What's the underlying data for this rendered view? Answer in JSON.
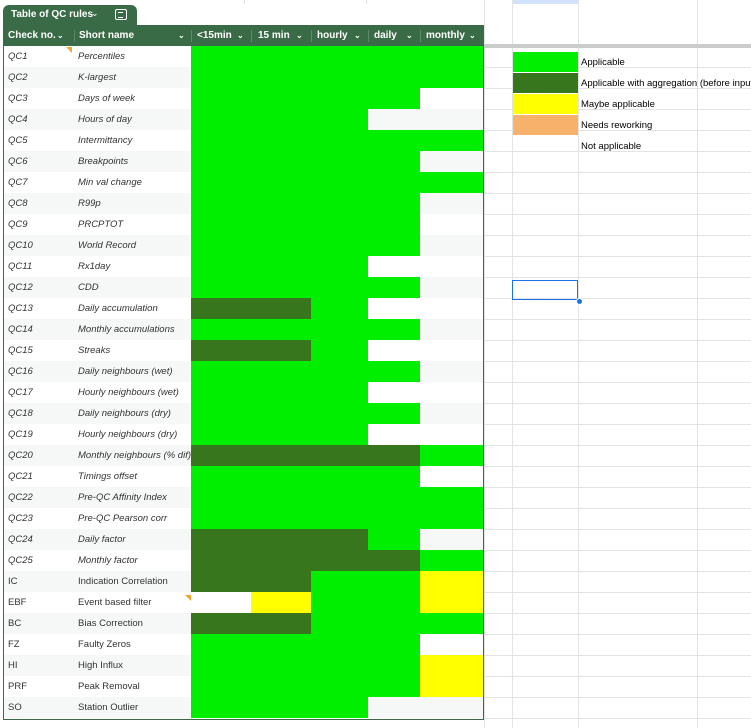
{
  "table": {
    "name": "Table of QC rules",
    "columns": [
      "Check no.",
      "Short name",
      "<15min",
      "15 min",
      "hourly",
      "daily",
      "monthly"
    ],
    "rows": [
      {
        "id": "QC1",
        "name": "Percentiles",
        "cells": [
          "applicable",
          "applicable",
          "applicable",
          "applicable",
          "applicable"
        ]
      },
      {
        "id": "QC2",
        "name": "K-largest",
        "cells": [
          "applicable",
          "applicable",
          "applicable",
          "applicable",
          "applicable"
        ]
      },
      {
        "id": "QC3",
        "name": "Days of week",
        "cells": [
          "applicable",
          "applicable",
          "applicable",
          "applicable",
          "not_applicable"
        ]
      },
      {
        "id": "QC4",
        "name": "Hours of day",
        "cells": [
          "applicable",
          "applicable",
          "applicable",
          "not_applicable",
          "not_applicable"
        ]
      },
      {
        "id": "QC5",
        "name": "Intermittancy",
        "cells": [
          "applicable",
          "applicable",
          "applicable",
          "applicable",
          "applicable"
        ]
      },
      {
        "id": "QC6",
        "name": "Breakpoints",
        "cells": [
          "applicable",
          "applicable",
          "applicable",
          "applicable",
          "not_applicable"
        ]
      },
      {
        "id": "QC7",
        "name": "Min val change",
        "cells": [
          "applicable",
          "applicable",
          "applicable",
          "applicable",
          "applicable"
        ]
      },
      {
        "id": "QC8",
        "name": "R99p",
        "cells": [
          "applicable",
          "applicable",
          "applicable",
          "applicable",
          "not_applicable"
        ]
      },
      {
        "id": "QC9",
        "name": "PRCPTOT",
        "cells": [
          "applicable",
          "applicable",
          "applicable",
          "applicable",
          "not_applicable"
        ]
      },
      {
        "id": "QC10",
        "name": "World Record",
        "cells": [
          "applicable",
          "applicable",
          "applicable",
          "applicable",
          "not_applicable"
        ]
      },
      {
        "id": "QC11",
        "name": "Rx1day",
        "cells": [
          "applicable",
          "applicable",
          "applicable",
          "not_applicable",
          "not_applicable"
        ]
      },
      {
        "id": "QC12",
        "name": "CDD",
        "cells": [
          "applicable",
          "applicable",
          "applicable",
          "applicable",
          "not_applicable"
        ]
      },
      {
        "id": "QC13",
        "name": "Daily accumulation",
        "cells": [
          "aggregation",
          "aggregation",
          "applicable",
          "not_applicable",
          "not_applicable"
        ]
      },
      {
        "id": "QC14",
        "name": "Monthly accumulations",
        "cells": [
          "applicable",
          "applicable",
          "applicable",
          "applicable",
          "not_applicable"
        ]
      },
      {
        "id": "QC15",
        "name": "Streaks",
        "cells": [
          "aggregation",
          "aggregation",
          "applicable",
          "not_applicable",
          "not_applicable"
        ]
      },
      {
        "id": "QC16",
        "name": "Daily neighbours (wet)",
        "cells": [
          "applicable",
          "applicable",
          "applicable",
          "applicable",
          "not_applicable"
        ]
      },
      {
        "id": "QC17",
        "name": "Hourly neighbours (wet)",
        "cells": [
          "applicable",
          "applicable",
          "applicable",
          "not_applicable",
          "not_applicable"
        ]
      },
      {
        "id": "QC18",
        "name": "Daily neighbours (dry)",
        "cells": [
          "applicable",
          "applicable",
          "applicable",
          "applicable",
          "not_applicable"
        ]
      },
      {
        "id": "QC19",
        "name": "Hourly neighbours (dry)",
        "cells": [
          "applicable",
          "applicable",
          "applicable",
          "not_applicable",
          "not_applicable"
        ]
      },
      {
        "id": "QC20",
        "name": "Monthly neighbours (% dif)",
        "cells": [
          "aggregation",
          "aggregation",
          "aggregation",
          "aggregation",
          "applicable"
        ]
      },
      {
        "id": "QC21",
        "name": "Timings offset",
        "cells": [
          "applicable",
          "applicable",
          "applicable",
          "applicable",
          "not_applicable"
        ]
      },
      {
        "id": "QC22",
        "name": "Pre-QC Affinity Index",
        "cells": [
          "applicable",
          "applicable",
          "applicable",
          "applicable",
          "applicable"
        ]
      },
      {
        "id": "QC23",
        "name": "Pre-QC Pearson corr",
        "cells": [
          "applicable",
          "applicable",
          "applicable",
          "applicable",
          "applicable"
        ]
      },
      {
        "id": "QC24",
        "name": "Daily factor",
        "cells": [
          "aggregation",
          "aggregation",
          "aggregation",
          "applicable",
          "not_applicable"
        ]
      },
      {
        "id": "QC25",
        "name": "Monthly factor",
        "cells": [
          "aggregation",
          "aggregation",
          "aggregation",
          "aggregation",
          "applicable"
        ]
      },
      {
        "id": "IC",
        "name": "Indication Correlation",
        "cells": [
          "aggregation",
          "aggregation",
          "applicable",
          "applicable",
          "maybe"
        ]
      },
      {
        "id": "EBF",
        "name": "Event based filter",
        "cells": [
          "not_applicable",
          "maybe",
          "applicable",
          "applicable",
          "maybe"
        ]
      },
      {
        "id": "BC",
        "name": "Bias Correction",
        "cells": [
          "aggregation",
          "aggregation",
          "applicable",
          "applicable",
          "applicable"
        ]
      },
      {
        "id": "FZ",
        "name": "Faulty Zeros",
        "cells": [
          "applicable",
          "applicable",
          "applicable",
          "applicable",
          "not_applicable"
        ]
      },
      {
        "id": "HI",
        "name": "High Influx",
        "cells": [
          "applicable",
          "applicable",
          "applicable",
          "applicable",
          "maybe"
        ]
      },
      {
        "id": "PRF",
        "name": "Peak Removal",
        "cells": [
          "applicable",
          "applicable",
          "applicable",
          "applicable",
          "maybe"
        ]
      },
      {
        "id": "SO",
        "name": "Station Outlier",
        "cells": [
          "applicable",
          "applicable",
          "applicable",
          "not_applicable",
          "not_applicable"
        ]
      }
    ]
  },
  "legend": [
    {
      "key": "applicable",
      "label": "Applicable",
      "color": "#00ee00"
    },
    {
      "key": "aggregation",
      "label": "Applicable with aggregation (before input)",
      "color": "#38761d"
    },
    {
      "key": "maybe",
      "label": "Maybe applicable",
      "color": "#ffff00"
    },
    {
      "key": "reworking",
      "label": "Needs reworking",
      "color": "#f6b26b"
    },
    {
      "key": "not_applicable",
      "label": "Not applicable",
      "color": "#ffffff"
    }
  ]
}
